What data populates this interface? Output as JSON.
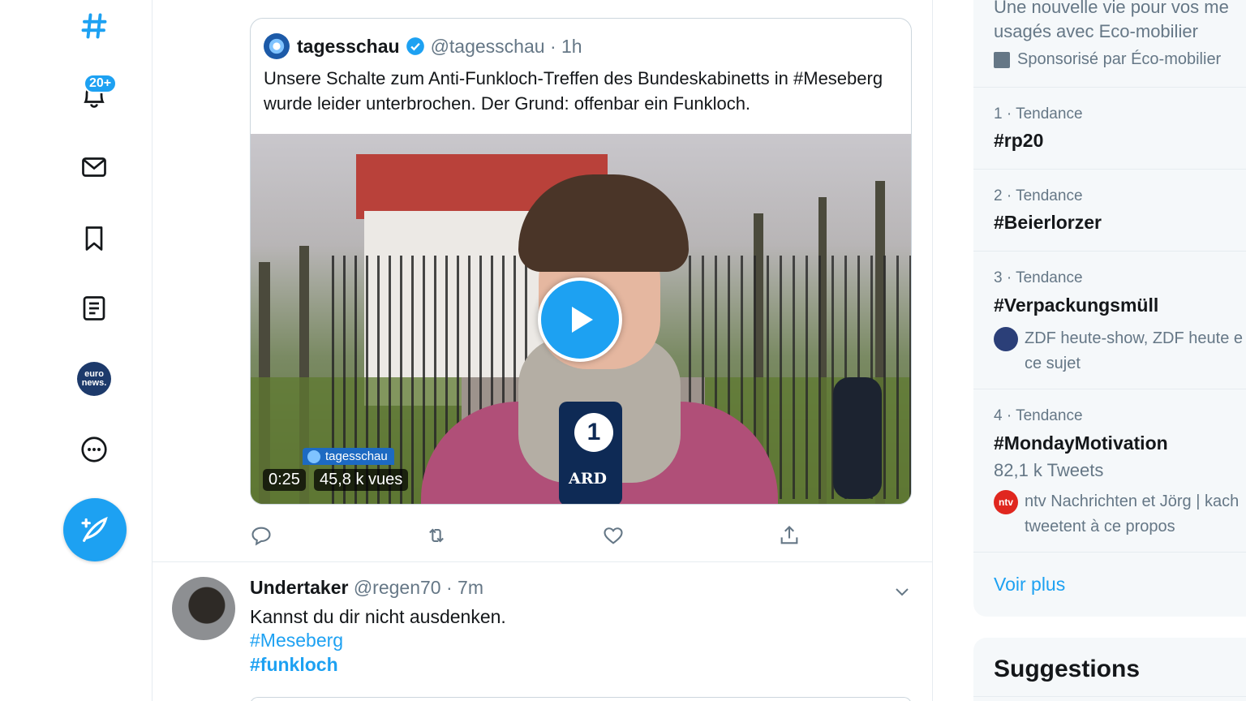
{
  "nav": {
    "notifications_badge": "20+",
    "euronews_label": "euro news."
  },
  "quoted_tweet": {
    "name": "tagesschau",
    "handle": "@tagesschau",
    "time": "· 1h",
    "text": "Unsere Schalte zum Anti-Funkloch-Treffen des Bundeskabinetts in #Meseberg wurde leider unterbrochen. Der Grund: offenbar ein Funkloch.",
    "video": {
      "lower_third": "tagesschau",
      "duration": "0:25",
      "views": "45,8 k vues",
      "mic_logo_text": "ARD",
      "mic_logo_number": "1"
    }
  },
  "tweet": {
    "name": "Undertaker",
    "handle": "@regen70",
    "time": "· 7m",
    "text": "Kannst du dir nicht ausdenken.",
    "hashtag1": "#Meseberg",
    "hashtag2": "#funkloch"
  },
  "sidebar": {
    "ad_line1": "Une nouvelle vie pour vos me",
    "ad_line2": "usagés avec Eco-mobilier",
    "ad_sponsor": "Sponsorisé par Éco-mobilier",
    "trends": [
      {
        "meta": "1 · Tendance",
        "tag": "#rp20"
      },
      {
        "meta": "2 · Tendance",
        "tag": "#Beierlorzer"
      },
      {
        "meta": "3 · Tendance",
        "tag": "#Verpackungsmüll",
        "ctx1": "ZDF heute-show, ZDF heute e",
        "ctx2": "ce sujet"
      },
      {
        "meta": "4 · Tendance",
        "tag": "#MondayMotivation",
        "count": "82,1 k Tweets",
        "ctx_icon_text": "ntv",
        "ctx1": "ntv Nachrichten et Jörg | kach",
        "ctx2": "tweetent à ce propos"
      }
    ],
    "show_more": "Voir plus",
    "suggestions_title": "Suggestions"
  },
  "colors": {
    "accent": "#1da1f2",
    "text_secondary": "#657786",
    "border": "#e6ecf0"
  }
}
